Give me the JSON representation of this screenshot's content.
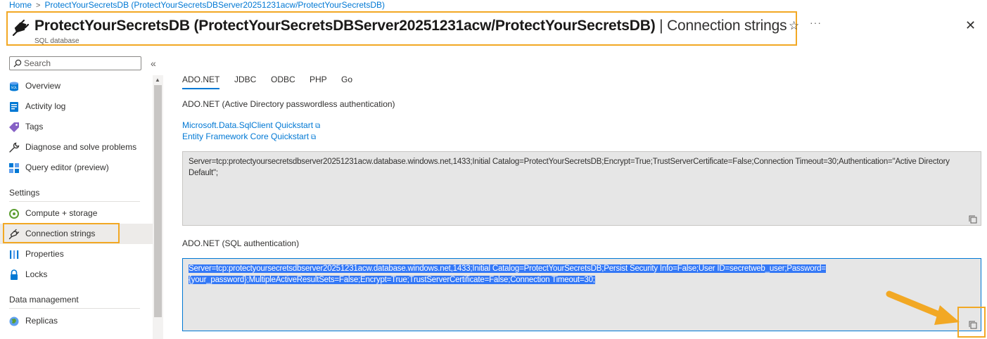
{
  "breadcrumb": {
    "home": "Home",
    "current": "ProtectYourSecretsDB (ProtectYourSecretsDBServer20251231acw/ProtectYourSecretsDB)"
  },
  "header": {
    "title": "ProtectYourSecretsDB (ProtectYourSecretsDBServer20251231acw/ProtectYourSecretsDB)",
    "separator": "|",
    "page": "Connection strings",
    "subtitle": "SQL database",
    "star": "☆",
    "more": "···",
    "close": "✕"
  },
  "sidebar": {
    "search_placeholder": "Search",
    "collapse": "«",
    "items": [
      {
        "label": "Overview",
        "icon": "sql-database-icon"
      },
      {
        "label": "Activity log",
        "icon": "activity-log-icon"
      },
      {
        "label": "Tags",
        "icon": "tag-icon"
      },
      {
        "label": "Diagnose and solve problems",
        "icon": "wrench-icon"
      },
      {
        "label": "Query editor (preview)",
        "icon": "query-editor-icon"
      }
    ],
    "settings_header": "Settings",
    "settings_items": [
      {
        "label": "Compute + storage",
        "icon": "compute-icon"
      },
      {
        "label": "Connection strings",
        "icon": "plug-icon",
        "active": true
      },
      {
        "label": "Properties",
        "icon": "properties-icon"
      },
      {
        "label": "Locks",
        "icon": "lock-icon"
      }
    ],
    "data_header": "Data management",
    "data_items": [
      {
        "label": "Replicas",
        "icon": "globe-icon"
      }
    ]
  },
  "tabs": [
    "ADO.NET",
    "JDBC",
    "ODBC",
    "PHP",
    "Go"
  ],
  "active_tab": "ADO.NET",
  "section1": {
    "label": "ADO.NET (Active Directory passwordless authentication)",
    "link1": "Microsoft.Data.SqlClient Quickstart",
    "link2": "Entity Framework Core Quickstart",
    "ext_icon": "⧉",
    "value": "Server=tcp:protectyoursecretsdbserver20251231acw.database.windows.net,1433;Initial Catalog=ProtectYourSecretsDB;Encrypt=True;TrustServerCertificate=False;Connection Timeout=30;Authentication=\"Active Directory Default\";"
  },
  "section2": {
    "label": "ADO.NET (SQL authentication)",
    "value": "Server=tcp:protectyoursecretsdbserver20251231acw.database.windows.net,1433;Initial Catalog=ProtectYourSecretsDB;Persist Security Info=False;User ID=secretweb_user;Password={your_password};MultipleActiveResultSets=False;Encrypt=True;TrustServerCertificate=False;Connection Timeout=30;"
  },
  "colors": {
    "accent": "#0078d4",
    "highlight": "#f2a824",
    "selection": "#3478f6"
  }
}
